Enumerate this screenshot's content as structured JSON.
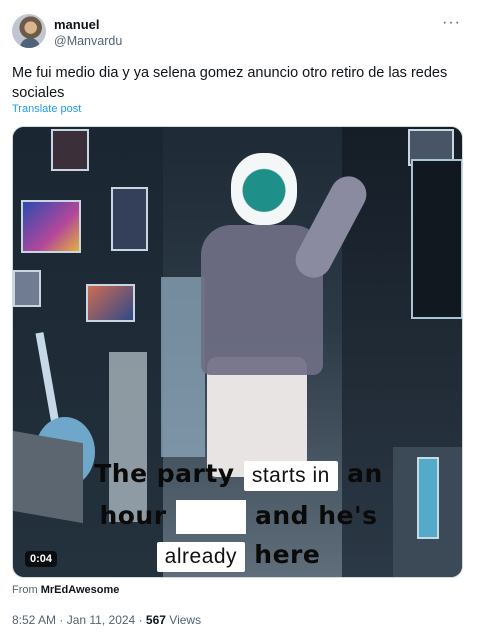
{
  "post": {
    "author_name": "manuel",
    "author_handle": "@Manvardu",
    "more_icon": "more-horizontal-icon",
    "text": "Me fui medio dia y ya selena gomez anuncio otro retiro de las redes sociales",
    "translate_link": "Translate post"
  },
  "media": {
    "caption": {
      "line1_a": "The party",
      "line1_b": "starts in",
      "line1_c": "an",
      "line2_a": "hour",
      "line2_b": "and he's",
      "line3_a": "already",
      "line3_b": "here"
    },
    "duration": "0:04"
  },
  "attribution": {
    "prefix": "From",
    "source": "MrEdAwesome"
  },
  "meta": {
    "time": "8:52 AM",
    "sep1": "·",
    "date": "Jan 11, 2024",
    "sep2": "·",
    "views_count": "567",
    "views_label": "Views"
  },
  "colors": {
    "link": "#1d9bf0",
    "secondary_text": "#536471",
    "primary_text": "#0f1419"
  }
}
